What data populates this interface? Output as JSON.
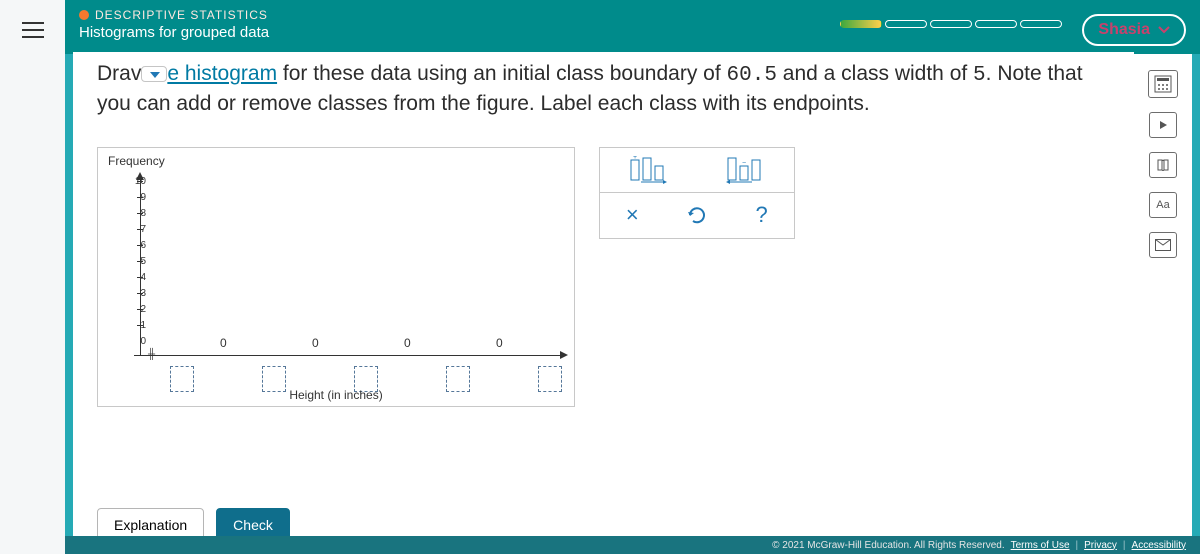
{
  "header": {
    "section": "DESCRIPTIVE STATISTICS",
    "subtitle": "Histograms for grouped data",
    "username": "Shasia",
    "progress_segments": 5,
    "progress_filled": 1
  },
  "instructions": {
    "prefix": "Drav",
    "linktext": "e histogram",
    "rest1": " for these data using an initial class boundary of ",
    "val1": "60.5",
    "rest2": " and a class width of ",
    "val2": "5",
    "rest3": ". Note that you can add or remove classes from the figure. Label each class with its endpoints."
  },
  "chart_data": {
    "type": "bar",
    "title": "",
    "ylabel": "Frequency",
    "xlabel": "Height (in inches)",
    "ylim": [
      0,
      10
    ],
    "yticks": [
      "10",
      "9",
      "8",
      "7",
      "6",
      "5",
      "4",
      "3",
      "2",
      "1",
      "0"
    ],
    "bar_display_labels": [
      "0",
      "0",
      "0",
      "0"
    ],
    "categories": [],
    "values": [
      0,
      0,
      0,
      0
    ]
  },
  "toolbox": {
    "addBar": "add-bar",
    "removeBar": "remove-bar",
    "clear": "×",
    "undo": "↺",
    "help": "?"
  },
  "buttons": {
    "explanation": "Explanation",
    "check": "Check"
  },
  "footer": {
    "copyright": "© 2021 McGraw-Hill Education. All Rights Reserved.",
    "terms": "Terms of Use",
    "privacy": "Privacy",
    "accessibility": "Accessibility"
  }
}
